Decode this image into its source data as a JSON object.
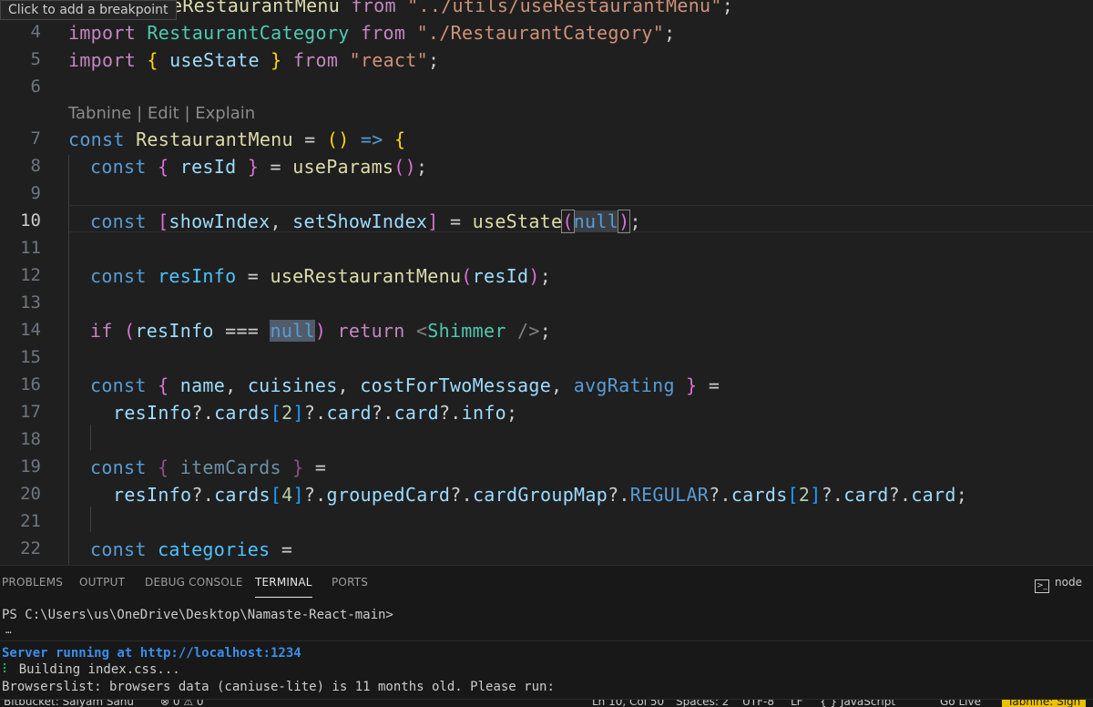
{
  "tooltip": "Click to add a breakpoint",
  "codelens": "Tabnine | Edit | Explain",
  "lines": [
    {
      "n": "4",
      "tokens": [
        [
          "kw",
          "import"
        ],
        [
          "",
          ""
        ],
        [
          "t",
          " RestaurantCategory"
        ],
        [
          "kw",
          " from"
        ],
        [
          "s",
          " \"./RestaurantCategory\""
        ],
        [
          "",
          ";"
        ]
      ]
    },
    {
      "n": "5",
      "tokens": [
        [
          "kw",
          "import"
        ],
        [
          "b1",
          " {"
        ],
        [
          "v",
          " useState"
        ],
        [
          "b1",
          " }"
        ],
        [
          "kw",
          " from"
        ],
        [
          "s",
          " \"react\""
        ],
        [
          "",
          ";"
        ]
      ]
    }
  ],
  "code": {
    "l3": "eRestaurantMenu from \"../utils/useRestaurantMenu\";",
    "l4": "import RestaurantCategory from \"./RestaurantCategory\";",
    "l5": "import { useState } from \"react\";",
    "l7": "const RestaurantMenu = () => {",
    "l8": "const { resId } = useParams();",
    "l10": "const [showIndex, setShowIndex] = useState(null);",
    "l12": "const resInfo = useRestaurantMenu(resId);",
    "l14": "if (resInfo === null) return <Shimmer />;",
    "l16": "const { name, cuisines, costForTwoMessage, avgRating } =",
    "l17": "resInfo?.cards[2]?.card?.card?.info;",
    "l19": "const { itemCards } =",
    "l20": "resInfo?.cards[4]?.groupedCard?.cardGroupMap?.REGULAR?.cards[2]?.card?.card;",
    "l22": "const categories ="
  },
  "line_numbers": [
    "4",
    "5",
    "6",
    "7",
    "8",
    "9",
    "10",
    "11",
    "12",
    "13",
    "14",
    "15",
    "16",
    "17",
    "18",
    "19",
    "20",
    "21",
    "22"
  ],
  "panel": {
    "tabs": [
      "PROBLEMS",
      "OUTPUT",
      "DEBUG CONSOLE",
      "TERMINAL",
      "PORTS"
    ],
    "active_tab": "TERMINAL",
    "terminal_name": "node",
    "terminal_icon": "terminal-icon"
  },
  "terminal": {
    "prompt": "PS C:\\Users\\us\\OneDrive\\Desktop\\Namaste-React-main>",
    "ellipsis": "…",
    "server": "Server running at http://localhost:1234",
    "spinner": "⠇",
    "building": " Building index.css...",
    "browserslist": "Browserslist: browsers data (caniuse-lite) is 11 months old. Please run:"
  },
  "status": {
    "branch": "Bitbucket: Saiyam Sahu",
    "problems": "⊗ 0 ⚠ 0",
    "position": "Ln 10, Col 50",
    "spaces": "Spaces: 2",
    "encoding": "UTF-8",
    "eol": "LF",
    "language": "{ } JavaScript",
    "golive": "Go Live",
    "tabnine": "Tabnine: Sign"
  }
}
